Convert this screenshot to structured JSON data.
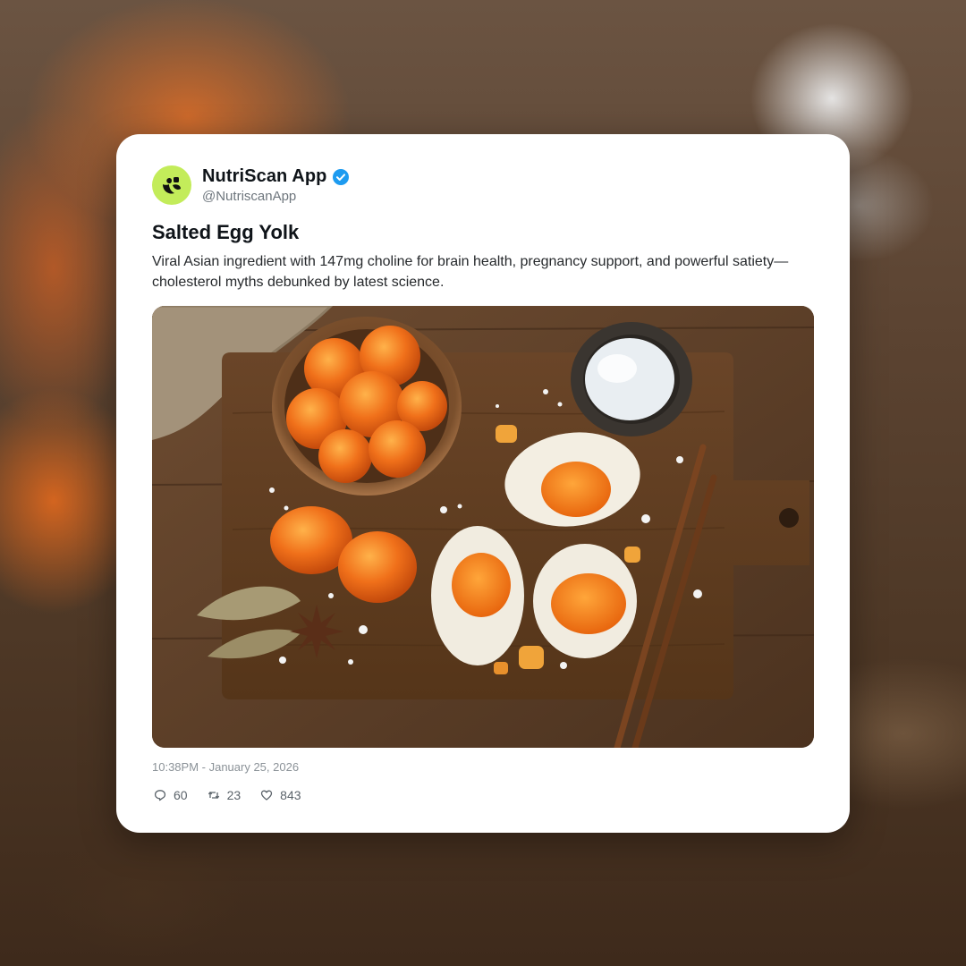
{
  "post": {
    "author": {
      "name": "NutriScan App",
      "handle": "@NutriscanApp",
      "verified": true,
      "avatar_color": "#c3ec5a"
    },
    "title": "Salted Egg Yolk",
    "description": "Viral Asian ingredient with 147mg choline for brain health, pregnancy support, and powerful satiety—cholesterol myths debunked by latest science.",
    "image": {
      "subject": "salted-egg-yolk-photo"
    },
    "timestamp": "10:38PM - January 25, 2026",
    "stats": {
      "replies": "60",
      "reposts": "23",
      "likes": "843"
    }
  },
  "colors": {
    "card_bg": "#ffffff",
    "verified_blue": "#1d9bf0",
    "text_primary": "#0f1419",
    "text_secondary": "#6e767d"
  },
  "icons": {
    "reply": "reply-icon",
    "repost": "repost-icon",
    "like": "heart-icon",
    "verified": "verified-badge-icon",
    "avatar": "nutriscan-logo-icon"
  }
}
